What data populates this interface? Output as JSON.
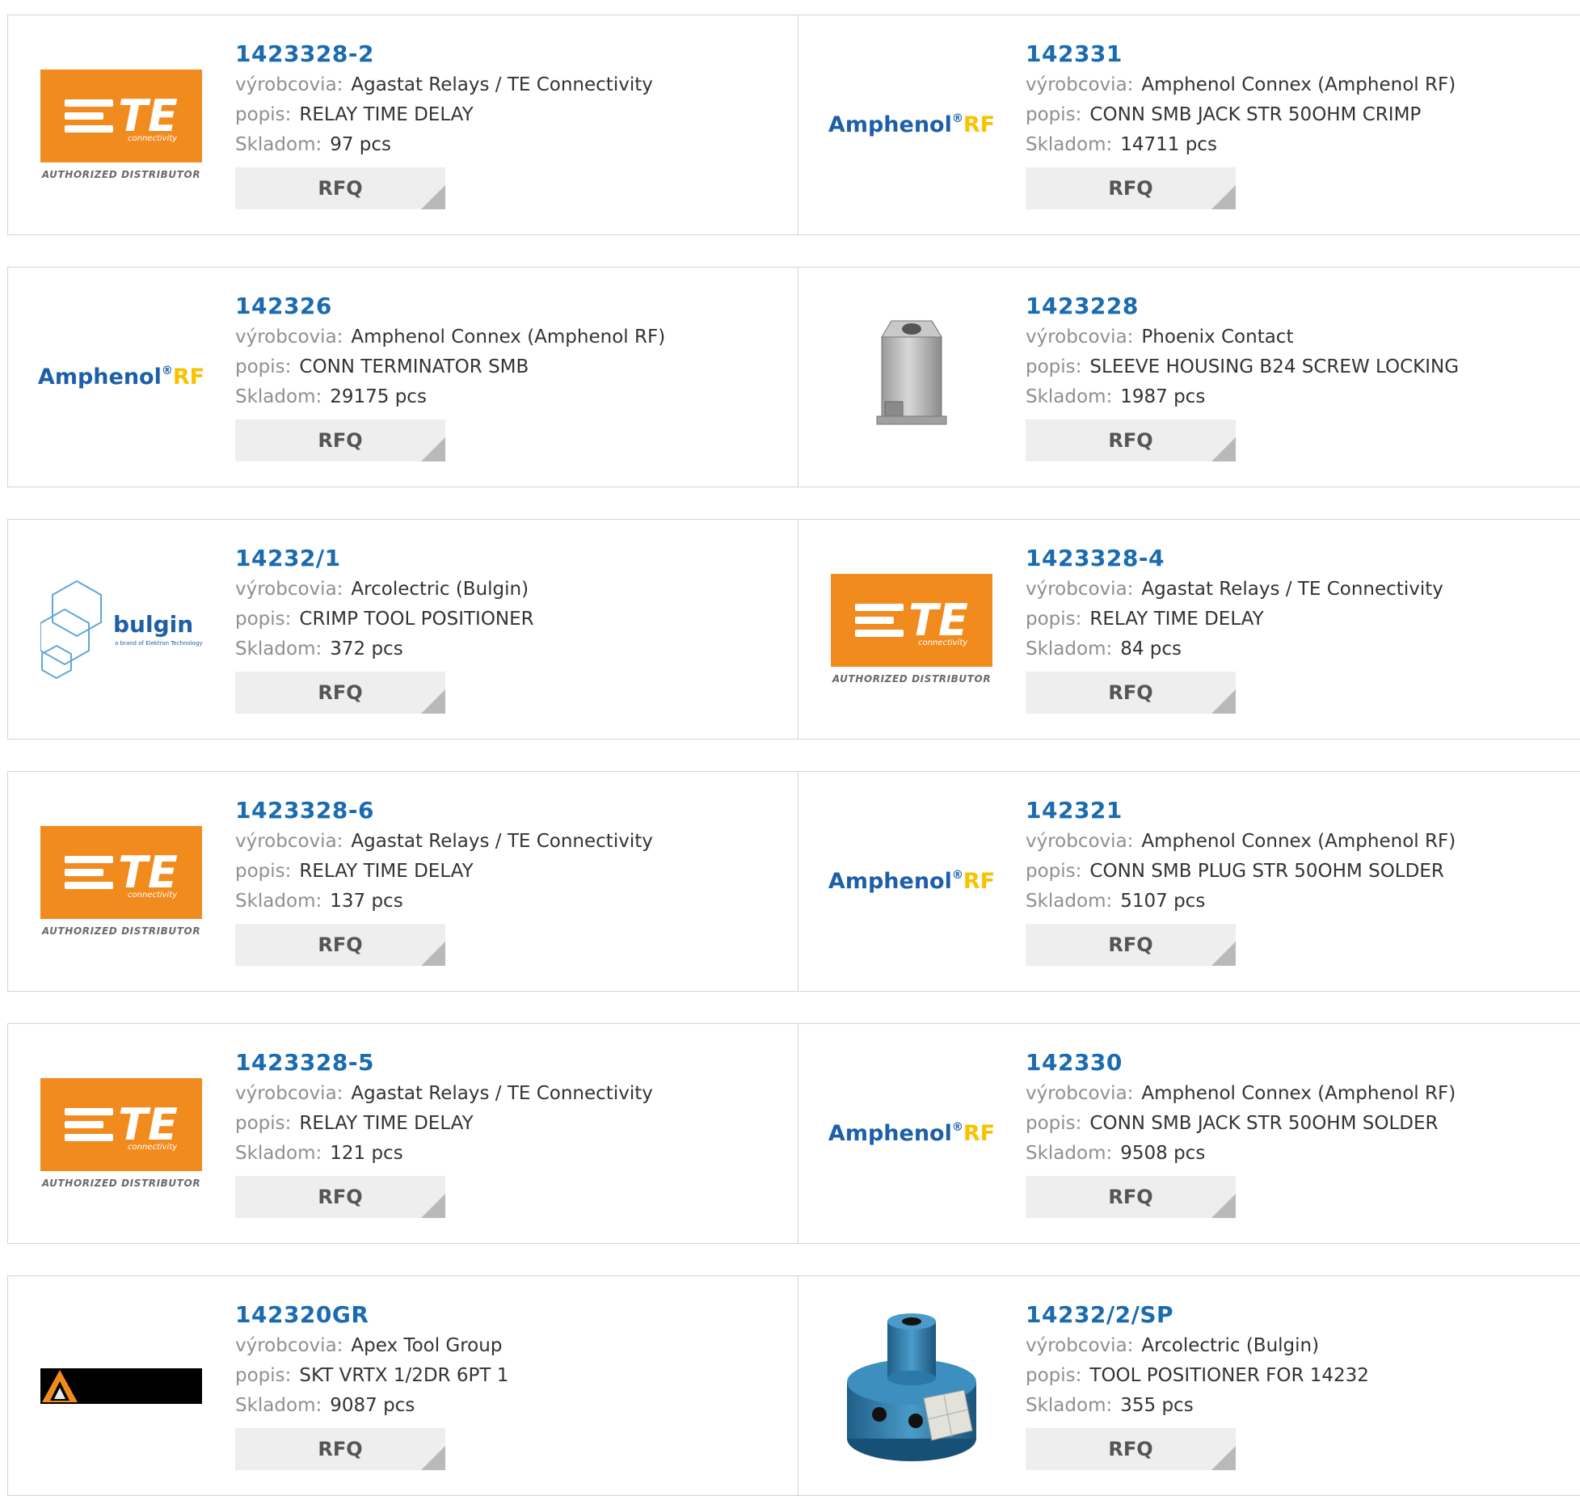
{
  "labels": {
    "manufacturer": "výrobcovia:",
    "description": "popis:",
    "stock": "Skladom:",
    "rfq": "RFQ"
  },
  "logos": {
    "te_text": "TE",
    "te_sub": "connectivity",
    "te_distributor": "AUTHORIZED DISTRIBUTOR",
    "amphenol_name": "Amphenol",
    "amphenol_reg": "®",
    "amphenol_rf": "RF",
    "bulgin_name": "bulgin",
    "bulgin_tagline": "a brand of Elektron Technology"
  },
  "colors": {
    "part_number": "#1a6bb0",
    "te_orange": "#f28b1e",
    "amphenol_blue": "#1d5fa8",
    "amphenol_rf_yellow": "#f7c200",
    "rfq_bg": "#eeeeee"
  },
  "rows": [
    {
      "left": {
        "pn": "1423328-2",
        "mfr": "Agastat Relays / TE Connectivity",
        "desc": "RELAY TIME DELAY",
        "stock": "97 pcs",
        "logo": "te-logo"
      },
      "right": {
        "pn": "142331",
        "mfr": "Amphenol Connex (Amphenol RF)",
        "desc": "CONN SMB JACK STR 50OHM CRIMP",
        "stock": "14711 pcs",
        "logo": "amphenol-logo"
      }
    },
    {
      "left": {
        "pn": "142326",
        "mfr": "Amphenol Connex (Amphenol RF)",
        "desc": "CONN TERMINATOR SMB",
        "stock": "29175 pcs",
        "logo": "amphenol-logo"
      },
      "right": {
        "pn": "1423228",
        "mfr": "Phoenix Contact",
        "desc": "SLEEVE HOUSING B24 SCREW LOCKING",
        "stock": "1987 pcs",
        "logo": "sleeve-housing-photo"
      }
    },
    {
      "left": {
        "pn": "14232/1",
        "mfr": "Arcolectric (Bulgin)",
        "desc": "CRIMP TOOL POSITIONER",
        "stock": "372 pcs",
        "logo": "bulgin-logo"
      },
      "right": {
        "pn": "1423328-4",
        "mfr": "Agastat Relays / TE Connectivity",
        "desc": "RELAY TIME DELAY",
        "stock": "84 pcs",
        "logo": "te-logo"
      }
    },
    {
      "left": {
        "pn": "1423328-6",
        "mfr": "Agastat Relays / TE Connectivity",
        "desc": "RELAY TIME DELAY",
        "stock": "137 pcs",
        "logo": "te-logo"
      },
      "right": {
        "pn": "142321",
        "mfr": "Amphenol Connex (Amphenol RF)",
        "desc": "CONN SMB PLUG STR 50OHM SOLDER",
        "stock": "5107 pcs",
        "logo": "amphenol-logo"
      }
    },
    {
      "left": {
        "pn": "1423328-5",
        "mfr": "Agastat Relays / TE Connectivity",
        "desc": "RELAY TIME DELAY",
        "stock": "121 pcs",
        "logo": "te-logo"
      },
      "right": {
        "pn": "142330",
        "mfr": "Amphenol Connex (Amphenol RF)",
        "desc": "CONN SMB JACK STR 50OHM SOLDER",
        "stock": "9508 pcs",
        "logo": "amphenol-logo"
      }
    },
    {
      "left": {
        "pn": "142320GR",
        "mfr": "Apex Tool Group",
        "desc": "SKT VRTX 1/2DR 6PT 1",
        "stock": "9087 pcs",
        "logo": "apex-logo"
      },
      "right": {
        "pn": "14232/2/SP",
        "mfr": "Arcolectric (Bulgin)",
        "desc": "TOOL POSITIONER FOR 14232",
        "stock": "355 pcs",
        "logo": "tool-positioner-photo"
      }
    }
  ]
}
